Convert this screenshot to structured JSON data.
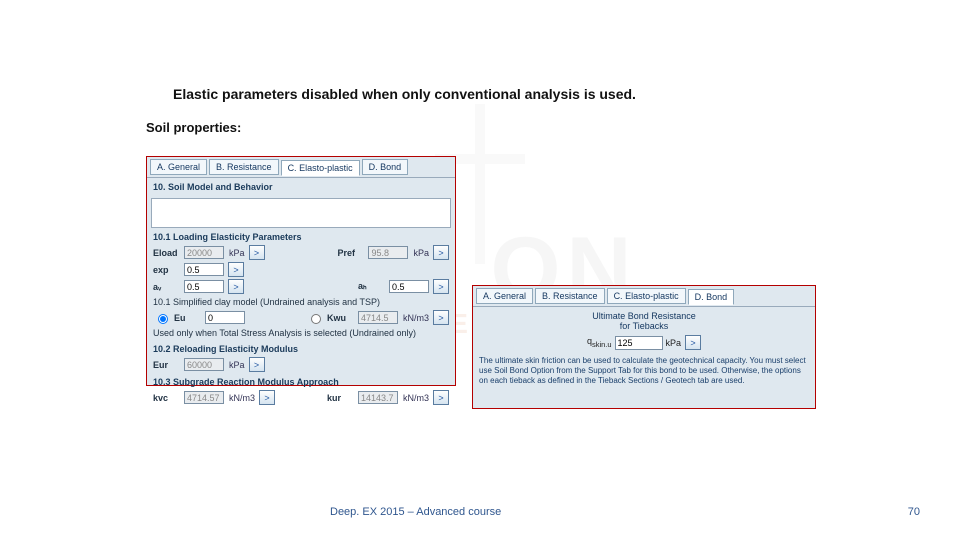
{
  "watermark_main": "DE                ON",
  "watermark_sub": "G E   X P E R T I S E",
  "title": "Elastic parameters disabled when only conventional analysis is used.",
  "subtitle": "Soil properties:",
  "tabs_left": {
    "a": "A. General",
    "b": "B. Resistance",
    "c": "C. Elasto-plastic",
    "d": "D. Bond"
  },
  "tabs_right": {
    "a": "A. General",
    "b": "B. Resistance",
    "c": "C. Elasto-plastic",
    "d": "D. Bond"
  },
  "left": {
    "s10": "10. Soil Model and Behavior",
    "s101": "10.1 Loading Elasticity Parameters",
    "eload_lbl": "Eload",
    "eload_val": "20000",
    "eload_unit": "kPa",
    "exp_lbl": "exp",
    "exp_val": "0.5",
    "av_lbl": "aᵥ",
    "av_val": "0.5",
    "pref_lbl": "Pref",
    "pref_val": "95.8",
    "pref_unit": "kPa",
    "ah_lbl": "aₕ",
    "ah_val": "0.5",
    "simpl": "10.1 Simplified clay model (Undrained analysis and TSP)",
    "eu_lbl": "Eu",
    "eu_val": "0",
    "kwu_lbl": "Kwu",
    "kwu_val": "4714.5",
    "kwu_unit": "kN/m3",
    "usedonly": "Used only when Total Stress Analysis is selected (Undrained only)",
    "s102": "10.2 Reloading Elasticity Modulus",
    "eur_lbl": "Eur",
    "eur_val": "60000",
    "eur_unit": "kPa",
    "s103": "10.3 Subgrade Reaction Modulus Approach",
    "kvc_lbl": "kvc",
    "kvc_val": "4714.57",
    "kvc_unit": "kN/m3",
    "kur_lbl": "kur",
    "kur_val": "14143.7",
    "kur_unit": "kN/m3"
  },
  "right": {
    "title1": "Ultimate Bond Resistance",
    "title2": "for Tiebacks",
    "qlbl": "q",
    "qsub": "skin.u",
    "qval": "125",
    "qunit": "kPa",
    "para": "The ultimate skin friction can be used to calculate the geotechnical capacity. You must select use Soil Bond Option from the Support Tab for this bond to be used. Otherwise, the options on each tieback as defined in the Tieback Sections / Geotech tab are used."
  },
  "footerLeft": "Deep. EX 2015 – Advanced course",
  "footerRight": "70",
  "go": ">"
}
